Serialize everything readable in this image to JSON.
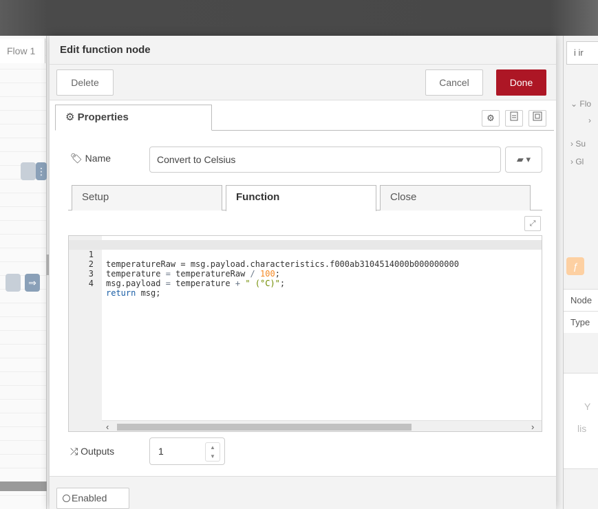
{
  "workspace": {
    "flow_tab_label": "Flow 1"
  },
  "sidebar": {
    "info_tab_label": "i  ir",
    "tree": [
      "⌄ Flo",
      "›",
      "› Su",
      "› Gl"
    ],
    "fn_badge": "ƒ",
    "rows": [
      "Node",
      "Type"
    ],
    "faded_text_1": "Y",
    "faded_text_2": "lis"
  },
  "editor": {
    "title": "Edit function node",
    "delete_label": "Delete",
    "cancel_label": "Cancel",
    "done_label": "Done",
    "properties_tab": "Properties",
    "name_label": "Name",
    "name_value": "Convert to Celsius",
    "sub_tabs": [
      "Setup",
      "Function",
      "Close"
    ],
    "active_sub_tab": "Function",
    "code_lines": [
      {
        "n": "1",
        "text": "temperatureRaw = msg.payload.characteristics.f000ab3104514000b000000000"
      },
      {
        "n": "2",
        "text": "temperature = temperatureRaw / 100;"
      },
      {
        "n": "3",
        "text": "msg.payload = temperature + \" (°C)\";"
      },
      {
        "n": "4",
        "text": "return msg;"
      }
    ],
    "outputs_label": "Outputs",
    "outputs_value": "1",
    "enabled_label": "Enabled"
  },
  "colors": {
    "done_button": "#ad1625",
    "function_badge": "#fdd0a2",
    "header_bar": "#484848"
  }
}
